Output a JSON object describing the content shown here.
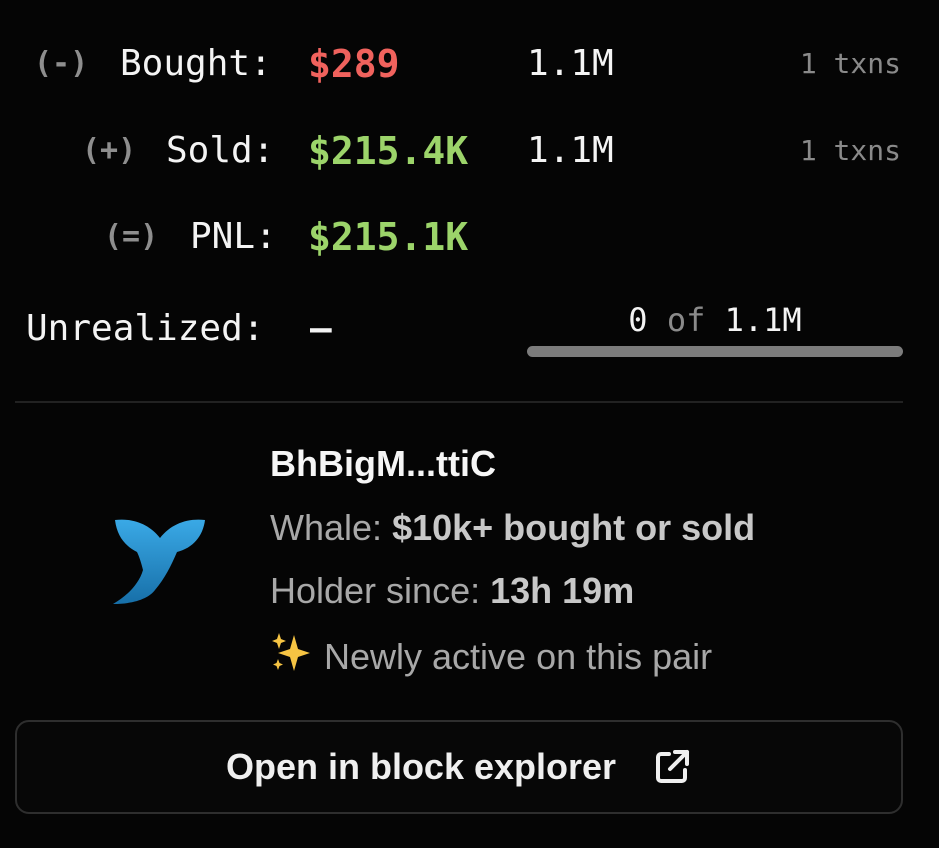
{
  "trades": {
    "bought": {
      "sign": "(-)",
      "label": "Bought:",
      "amount": "$289",
      "tokens": "1.1M",
      "txns": "1 txns"
    },
    "sold": {
      "sign": "(+)",
      "label": "Sold:",
      "amount": "$215.4K",
      "tokens": "1.1M",
      "txns": "1 txns"
    },
    "pnl": {
      "sign": "(=)",
      "label": "PNL:",
      "amount": "$215.1K"
    },
    "unrealized": {
      "label": "Unrealized:",
      "value": "–"
    }
  },
  "holding": {
    "held": "0",
    "of_text": "of",
    "total": "1.1M",
    "fraction": 0
  },
  "wallet": {
    "icon": "whale-tail-icon",
    "name": "BhBigM...ttiC",
    "whale_label": "Whale:",
    "whale_value": "$10k+ bought or sold",
    "since_label": "Holder since:",
    "since_value": "13h 19m",
    "new_icon": "sparkles-icon",
    "new_text": "Newly active on this pair"
  },
  "actions": {
    "explorer_label": "Open in block explorer",
    "explorer_icon": "external-link-icon"
  },
  "colors": {
    "negative": "#f0625d",
    "positive": "#9cd46a",
    "whale": "#1d8fd0"
  }
}
